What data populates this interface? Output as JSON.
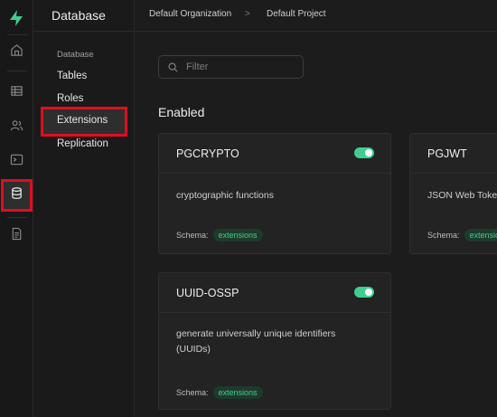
{
  "sidebar": {
    "title": "Database",
    "section": "Database",
    "items": [
      {
        "label": "Tables"
      },
      {
        "label": "Roles"
      },
      {
        "label": "Extensions"
      },
      {
        "label": "Replication"
      }
    ]
  },
  "header": {
    "organization": "Default Organization",
    "separator": ">",
    "project": "Default Project"
  },
  "filter": {
    "placeholder": "Filter"
  },
  "main": {
    "section_title": "Enabled",
    "cards": [
      {
        "name": "PGCRYPTO",
        "enabled": true,
        "description": "cryptographic functions",
        "schema_label": "Schema:",
        "schema": "extensions"
      },
      {
        "name": "PGJWT",
        "enabled": true,
        "description": "JSON Web Token API for PostgreSQL",
        "schema_label": "Schema:",
        "schema": "extensions"
      },
      {
        "name": "UUID-OSSP",
        "enabled": true,
        "description": "generate universally unique identifiers (UUIDs)",
        "schema_label": "Schema:",
        "schema": "extensions"
      }
    ]
  },
  "colors": {
    "brand": "#3ecf8e",
    "highlight": "#e00d1f",
    "background": "#1c1c1c"
  },
  "icons": [
    "supabase-logo-icon",
    "home-icon",
    "table-editor-icon",
    "users-icon",
    "sql-terminal-icon",
    "database-icon",
    "document-icon",
    "search-icon"
  ]
}
